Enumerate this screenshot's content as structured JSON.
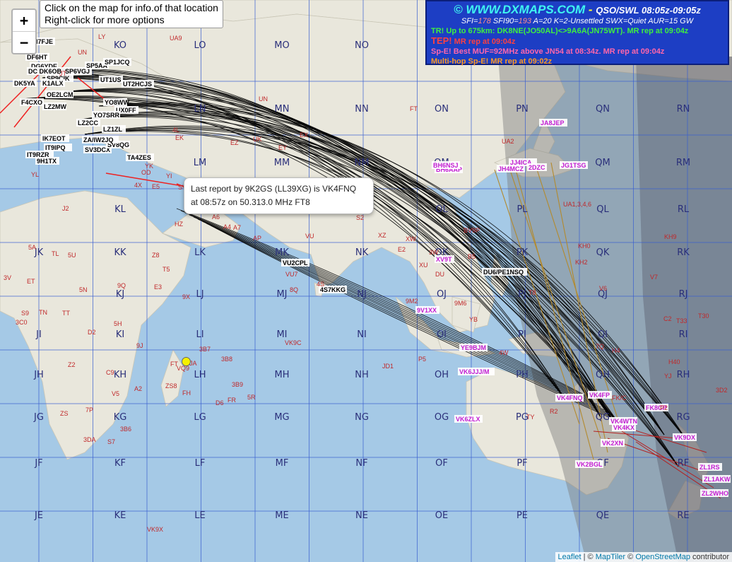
{
  "map": {
    "zoom_in": "+",
    "zoom_out": "−",
    "hint_line1": "Click on the map for info.of that location",
    "hint_line2": "Right-click for more options",
    "popup_line1": "Last report by 9K2GS (LL39XG) is VK4FNQ",
    "popup_line2": "at 08:57z on 50.313.0 MHz FT8",
    "attribution_leaflet": "Leaflet",
    "attribution_sep": " | © ",
    "attribution_maptiler": "MapTiler",
    "attribution_osm": "OpenStreetMap",
    "attribution_tail": " contributor",
    "colors": {
      "sea": "#a5c9e6",
      "land": "#e9e7dc",
      "grid": "#3a5fd0",
      "path": "#000000",
      "night": "#7d7d7d"
    }
  },
  "status": {
    "site": "© WWW.DXMAPS.COM",
    "dash": " - ",
    "qso": "QSO/SWL 08:05z-09:05z",
    "sfi_label": "SFI=",
    "sfi_value": "178",
    "sfi90_label": "SFI90=",
    "sfi90_value": "193",
    "rest": "A=20 K=2-Unsettled SWX=Quiet AUR=15 GW",
    "tr_line": "TR! Up to 675km: DK8NE(JO50AL)<>9A6A(JN75WT). MR rep at 09:04z",
    "tep_tag": "TEP!",
    "tep_text": " MR rep at 09:04z",
    "spe_line": "Sp-E! Best MUF=92MHz above JN54 at 08:34z. MR rep at 09:04z",
    "multi_tag": "Multi-hop Sp-E!",
    "multi_text": " MR rep at 09:02z"
  },
  "grid_squares": [
    [
      "KO",
      "LO",
      "MO",
      "NO"
    ],
    [
      "LN",
      "MN",
      "NN",
      "ON",
      "PN",
      "QN",
      "RN"
    ],
    [
      "LM",
      "MM",
      "NM",
      "OM",
      "PM",
      "QM",
      "RM"
    ],
    [
      "KL",
      "LL",
      "ML",
      "NL",
      "OL",
      "PL",
      "QL",
      "RL"
    ],
    [
      "JK",
      "KK",
      "LK",
      "MK",
      "NK",
      "OK",
      "PK",
      "QK",
      "RK"
    ],
    [
      "KJ",
      "LJ",
      "MJ",
      "NJ",
      "OJ",
      "PJ",
      "QJ",
      "RJ"
    ],
    [
      "JI",
      "KI",
      "LI",
      "MI",
      "NI",
      "OI",
      "PI",
      "QI",
      "RI"
    ],
    [
      "JH",
      "KH",
      "LH",
      "MH",
      "NH",
      "OH",
      "PH",
      "QH",
      "RH"
    ],
    [
      "JG",
      "KG",
      "LG",
      "MG",
      "NG",
      "OG",
      "PG",
      "QG",
      "RG"
    ],
    [
      "JF",
      "KF",
      "LF",
      "MF",
      "NF",
      "OF",
      "PF",
      "QF",
      "RF"
    ],
    [
      "JE",
      "KE",
      "LE",
      "ME",
      "NE",
      "OE",
      "PE",
      "QE",
      "RE"
    ]
  ],
  "callsigns": [
    "M7FJE",
    "DF6HT",
    "DG6YDE",
    "DC DK6OB",
    "SP6VGJ",
    "SP9CIK",
    "DK5YA",
    "K1ALX",
    "OE2LCM",
    "F4CXO",
    "LZ2MW",
    "YO8WW",
    "LZ2CC",
    "IK7EOT",
    "IT9RZR",
    "IT9IPQ",
    "SV3DCX",
    "9H1TX",
    "TA4ZES",
    "SV8QG",
    "UT2HCJS",
    "UT1US",
    "SP5AA",
    "SP1JCQ",
    "UX0FF",
    "YO7SRR",
    "LZ1ZL",
    "ZA/IW2JQ",
    "VU2CPL",
    "4S7KKG",
    "DU6/PE1NSQ",
    "JA8JEP",
    "JG1TSG",
    "JJ4ICA",
    "JH4MCZ",
    "2DZC",
    "BH6AAP",
    "BH6NSJ",
    "XV9T",
    "9V1XX",
    "YE9BJM",
    "VK6JJJ/M",
    "VK6ZLX",
    "VK4FNQ",
    "VK4FP",
    "VK4WTN",
    "VK4KX",
    "VK2XN",
    "VK2BGL",
    "VK9DX",
    "FK8CP",
    "ZL1RS",
    "ZL1AKW",
    "ZL2WHO"
  ],
  "prefixes": [
    "UN",
    "EX",
    "EZ",
    "UK",
    "EY",
    "EK",
    "4L",
    "YK",
    "OD",
    "4X",
    "YI",
    "E5",
    "SV",
    "HZ",
    "A6",
    "A4",
    "A7",
    "AP",
    "VU",
    "VU7",
    "8Q",
    "4S",
    "S2",
    "XZ",
    "E2",
    "XW",
    "3W",
    "XU",
    "9M2",
    "9M6",
    "BV9P",
    "DU",
    "B5",
    "YB",
    "4W",
    "KH0",
    "KH2",
    "V7",
    "V6",
    "T8",
    "KH9",
    "C2",
    "T33",
    "T30",
    "H4",
    "H40",
    "3D2",
    "YJ",
    "FK/C",
    "P2",
    "3C0",
    "S9",
    "TN",
    "TT",
    "TL",
    "5U",
    "5N",
    "5A",
    "ET",
    "J2",
    "E3",
    "T5",
    "Z8",
    "9X",
    "9Q",
    "5H",
    "D2",
    "9J",
    "Z2",
    "C9",
    "V5",
    "A2",
    "ZS",
    "7P",
    "3DA",
    "S7",
    "3B6",
    "3B7",
    "3B8",
    "3B9",
    "FR",
    "5R",
    "D6",
    "FH",
    "FT",
    "VQ9",
    "ZS8",
    "VK9C",
    "VK9X",
    "JD1",
    "P5",
    "UA1,3,4,6",
    "UA2",
    "UA9",
    "UN",
    "JT",
    "FT",
    "JA",
    "R2",
    "7Q",
    "TY",
    "3V",
    "YL",
    "LY"
  ]
}
